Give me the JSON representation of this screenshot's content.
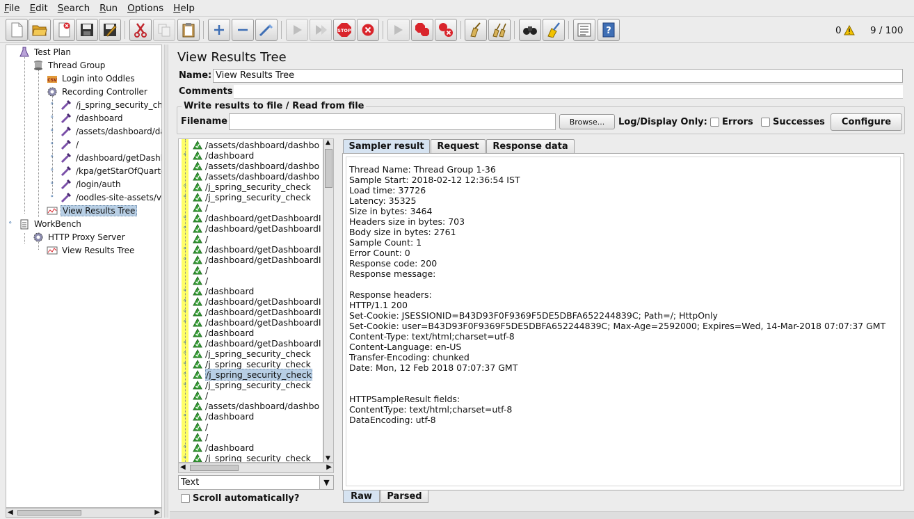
{
  "menu": [
    {
      "u": "F",
      "rest": "ile"
    },
    {
      "u": "E",
      "rest": "dit"
    },
    {
      "u": "S",
      "rest": "earch"
    },
    {
      "u": "R",
      "rest": "un"
    },
    {
      "u": "O",
      "rest": "ptions"
    },
    {
      "u": "H",
      "rest": "elp"
    }
  ],
  "status": {
    "errors": "0",
    "threads": "9 / 100"
  },
  "colors": {
    "selection": "#b8cfe5",
    "tab_active": "#d6e3f1",
    "warning": "#f2c200",
    "stop": "#d9242b",
    "highlight": "#ffff66"
  },
  "tree": [
    {
      "label": "Test Plan",
      "icon": "flask-icon"
    },
    {
      "label": "Thread Group",
      "icon": "spool-icon"
    },
    {
      "label": "Login into Oddles",
      "icon": "csv-data-icon"
    },
    {
      "label": "Recording Controller",
      "icon": "gear-icon"
    },
    {
      "label": "/j_spring_security_che",
      "icon": "pipette-icon"
    },
    {
      "label": "/dashboard",
      "icon": "pipette-icon"
    },
    {
      "label": "/assets/dashboard/da",
      "icon": "pipette-icon"
    },
    {
      "label": "/",
      "icon": "pipette-icon"
    },
    {
      "label": "/dashboard/getDashb",
      "icon": "pipette-icon"
    },
    {
      "label": "/kpa/getStarOfQuarte",
      "icon": "pipette-icon"
    },
    {
      "label": "/login/auth",
      "icon": "pipette-icon"
    },
    {
      "label": "/oodles-site-assets/vi",
      "icon": "pipette-icon"
    },
    {
      "label": "View Results Tree",
      "icon": "chart-icon"
    },
    {
      "label": "WorkBench",
      "icon": "clipboard-icon"
    },
    {
      "label": "HTTP Proxy Server",
      "icon": "gear-icon"
    },
    {
      "label": "View Results Tree",
      "icon": "chart-icon"
    }
  ],
  "panel": {
    "title": "View Results Tree",
    "name_label": "Name:",
    "name_value": "View Results Tree",
    "comments_label": "Comments:",
    "file_legend": "Write results to file / Read from file",
    "filename_label": "Filename",
    "filename_value": "",
    "browse": "Browse...",
    "log_display": "Log/Display Only:",
    "errors": "Errors",
    "successes": "Successes",
    "configure": "Configure"
  },
  "results": [
    "/assets/dashboard/dashbo",
    "/dashboard",
    "/assets/dashboard/dashbo",
    "/assets/dashboard/dashbo",
    "/j_spring_security_check",
    "/j_spring_security_check",
    "/",
    "/dashboard/getDashboardI",
    "/dashboard/getDashboardI",
    "/",
    "/dashboard/getDashboardI",
    "/dashboard/getDashboardI",
    "/",
    "/",
    "/dashboard",
    "/dashboard/getDashboardI",
    "/dashboard/getDashboardI",
    "/dashboard/getDashboardI",
    "/dashboard",
    "/dashboard/getDashboardI",
    "/j_spring_security_check",
    "/j_spring_security_check",
    "/j_spring_security_check",
    "/j_spring_security_check",
    "/",
    "/assets/dashboard/dashbo",
    "/dashboard",
    "/",
    "/",
    "/dashboard",
    "/j_spring_security_check"
  ],
  "selected_result": 22,
  "renderer": "Text",
  "scroll_auto": "Scroll automatically?",
  "tabs": [
    "Sampler result",
    "Request",
    "Response data"
  ],
  "bottom_tabs": [
    "Raw",
    "Parsed"
  ],
  "sampler_lines": [
    "Thread Name: Thread Group 1-36",
    "Sample Start: 2018-02-12 12:36:54 IST",
    "Load time: 37726",
    "Latency: 35325",
    "Size in bytes: 3464",
    "Headers size in bytes: 703",
    "Body size in bytes: 2761",
    "Sample Count: 1",
    "Error Count: 0",
    "Response code: 200",
    "Response message:",
    "",
    "Response headers:",
    "HTTP/1.1 200",
    "Set-Cookie: JSESSIONID=B43D93F0F9369F5DE5DBFA652244839C; Path=/; HttpOnly",
    "Set-Cookie: user=B43D93F0F9369F5DE5DBFA652244839C; Max-Age=2592000; Expires=Wed, 14-Mar-2018 07:07:37 GMT",
    "Content-Type: text/html;charset=utf-8",
    "Content-Language: en-US",
    "Transfer-Encoding: chunked",
    "Date: Mon, 12 Feb 2018 07:07:37 GMT",
    "",
    "",
    "HTTPSampleResult fields:",
    "ContentType: text/html;charset=utf-8",
    "DataEncoding: utf-8"
  ]
}
